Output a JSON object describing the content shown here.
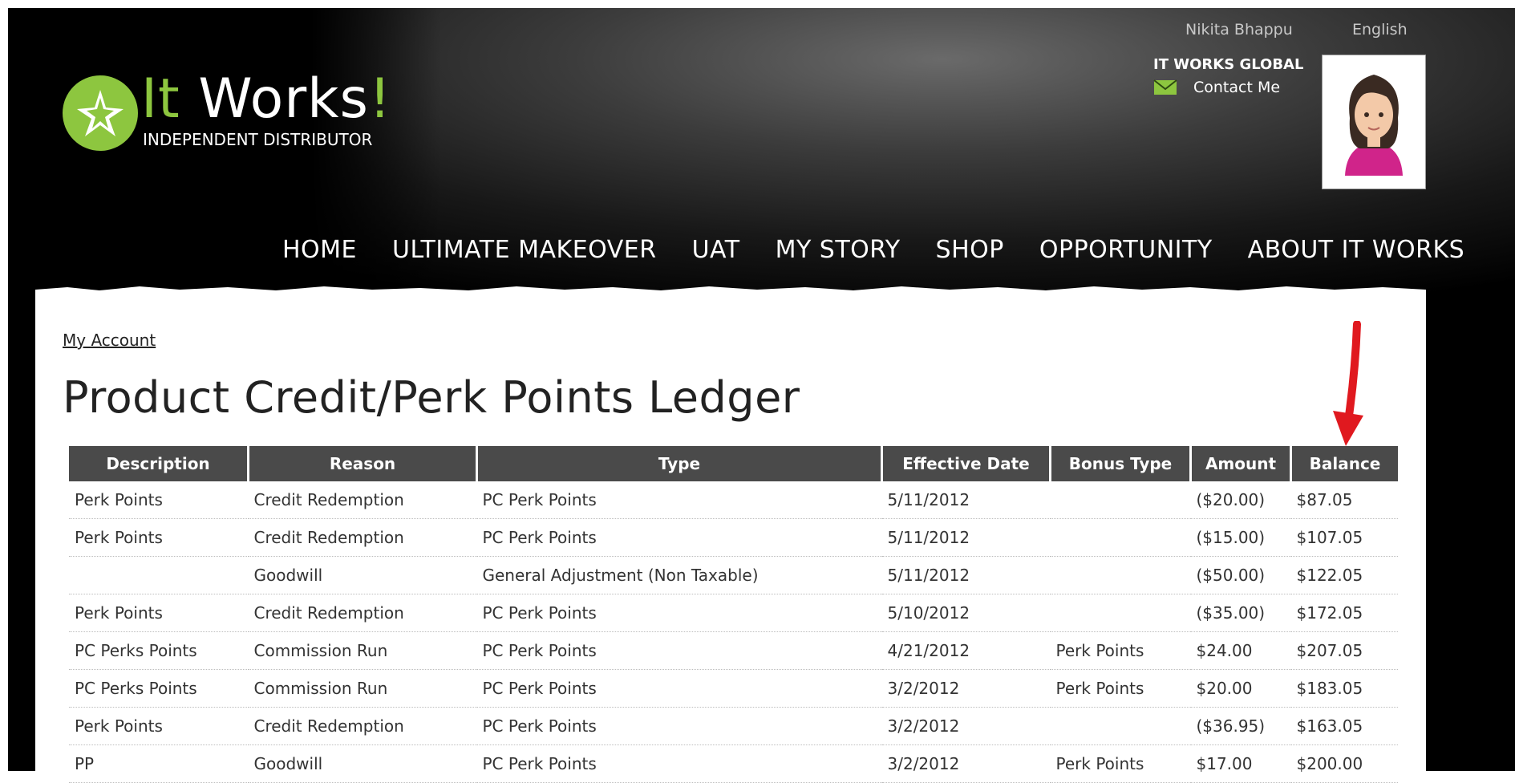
{
  "header": {
    "logo": {
      "main_it": "It",
      "main_works": "Works",
      "exclaim": "!",
      "sub": "INDEPENDENT DISTRIBUTOR"
    },
    "user_name": "Nikita Bhappu",
    "language": "English",
    "brand": "IT WORKS GLOBAL",
    "contact_label": "Contact Me",
    "mail_icon": "envelope-icon",
    "avatar_icon": "female-avatar-icon"
  },
  "nav": {
    "items": [
      "HOME",
      "ULTIMATE MAKEOVER",
      "UAT",
      "MY STORY",
      "SHOP",
      "OPPORTUNITY",
      "ABOUT IT WORKS"
    ]
  },
  "main": {
    "breadcrumb": "My Account",
    "title": "Product Credit/Perk Points Ledger",
    "table": {
      "headers": [
        "Description",
        "Reason",
        "Type",
        "Effective Date",
        "Bonus Type",
        "Amount",
        "Balance"
      ],
      "rows": [
        [
          "Perk Points",
          "Credit Redemption",
          "PC Perk Points",
          "5/11/2012",
          "",
          "($20.00)",
          "$87.05"
        ],
        [
          "Perk Points",
          "Credit Redemption",
          "PC Perk Points",
          "5/11/2012",
          "",
          "($15.00)",
          "$107.05"
        ],
        [
          "",
          "Goodwill",
          "General Adjustment (Non Taxable)",
          "5/11/2012",
          "",
          "($50.00)",
          "$122.05"
        ],
        [
          "Perk Points",
          "Credit Redemption",
          "PC Perk Points",
          "5/10/2012",
          "",
          "($35.00)",
          "$172.05"
        ],
        [
          "PC Perks Points",
          "Commission Run",
          "PC Perk Points",
          "4/21/2012",
          "Perk Points",
          "$24.00",
          "$207.05"
        ],
        [
          "PC Perks Points",
          "Commission Run",
          "PC Perk Points",
          "3/2/2012",
          "Perk Points",
          "$20.00",
          "$183.05"
        ],
        [
          "Perk Points",
          "Credit Redemption",
          "PC Perk Points",
          "3/2/2012",
          "",
          "($36.95)",
          "$163.05"
        ],
        [
          "PP",
          "Goodwill",
          "PC Perk Points",
          "3/2/2012",
          "Perk Points",
          "$17.00",
          "$200.00"
        ]
      ]
    },
    "annotation_icon": "red-arrow-icon"
  },
  "colors": {
    "logo_green": "#8dc63f",
    "table_header_bg": "#4a4a4a",
    "annotation_red": "#e0191f"
  }
}
